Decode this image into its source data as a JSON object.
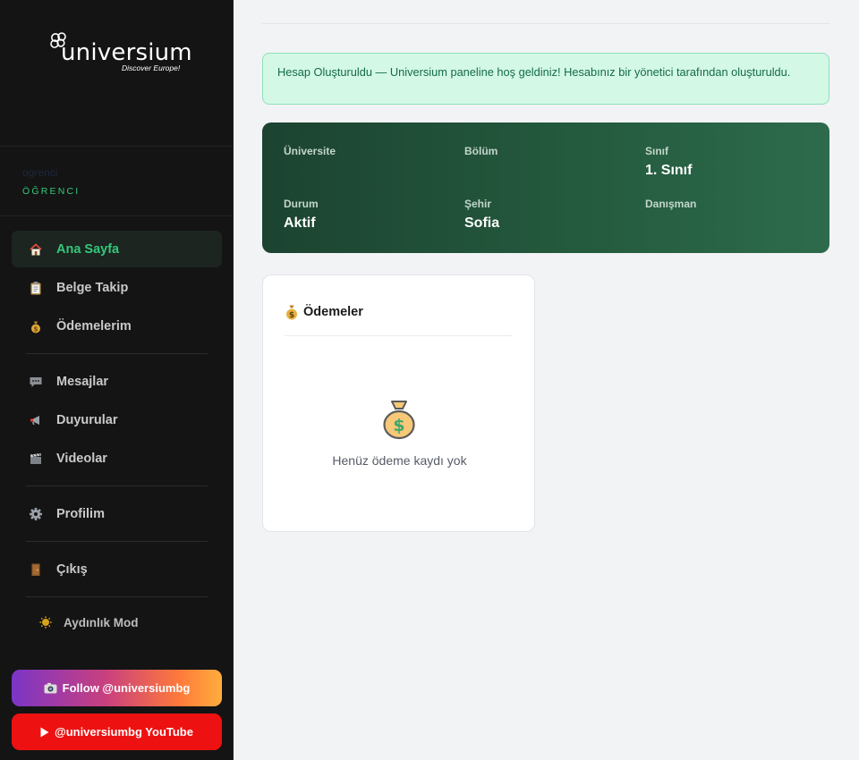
{
  "brand": {
    "name": "universium",
    "tagline": "Discover Europe!"
  },
  "user": {
    "name": "ogrenci",
    "role": "ÖĞRENCI"
  },
  "nav": {
    "home": "Ana Sayfa",
    "documents": "Belge Takip",
    "payments": "Ödemelerim",
    "messages": "Mesajlar",
    "announcements": "Duyurular",
    "videos": "Videolar",
    "profile": "Profilim",
    "logout": "Çıkış"
  },
  "theme_toggle": "Aydınlık Mod",
  "social": {
    "instagram": "Follow @universiumbg",
    "youtube": "@universiumbg YouTube"
  },
  "alert": {
    "text": "Hesap Oluşturuldu — Universium paneline hoş geldiniz! Hesabınız bir yönetici tarafından oluşturuldu."
  },
  "student_info": {
    "university_label": "Üniversite",
    "university_value": "",
    "department_label": "Bölüm",
    "department_value": "",
    "class_label": "Sınıf",
    "class_value": "1. Sınıf",
    "status_label": "Durum",
    "status_value": "Aktif",
    "city_label": "Şehir",
    "city_value": "Sofia",
    "advisor_label": "Danışman",
    "advisor_value": ""
  },
  "payments_card": {
    "title": "Ödemeler",
    "empty_text": "Henüz ödeme kaydı yok"
  },
  "colors": {
    "accent": "#34c77b",
    "sidebar_bg": "#141414",
    "card_green": "#245a3e",
    "alert_bg": "#d4f8e6"
  },
  "icons": [
    "house-icon",
    "clipboard-icon",
    "money-bag-icon",
    "speech-bubble-icon",
    "megaphone-icon",
    "clapper-icon",
    "gear-icon",
    "door-icon",
    "sun-icon",
    "camera-icon",
    "play-icon"
  ]
}
